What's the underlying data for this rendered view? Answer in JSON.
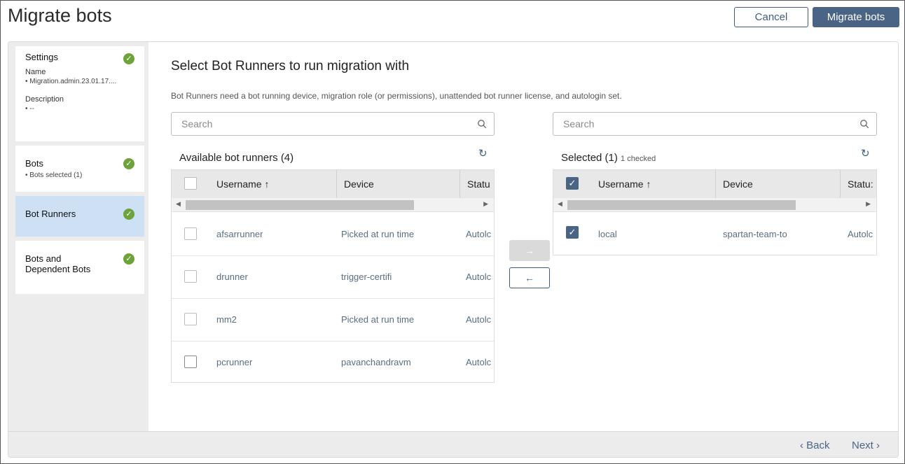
{
  "header": {
    "title": "Migrate bots",
    "cancel_label": "Cancel",
    "migrate_label": "Migrate bots"
  },
  "sidebar": {
    "steps": [
      {
        "title": "Settings",
        "completed": true,
        "fields": [
          {
            "label": "Name",
            "value": "• Migration.admin.23.01.17...."
          },
          {
            "label": "Description",
            "value": "• --"
          }
        ]
      },
      {
        "title": "Bots",
        "completed": true,
        "detail": "• Bots selected (1)"
      },
      {
        "title": "Bot Runners",
        "completed": true,
        "active": true
      },
      {
        "title": "Bots and\nDependent Bots",
        "title_line1": "Bots and",
        "title_line2": "Dependent Bots",
        "completed": true
      }
    ]
  },
  "main": {
    "heading": "Select Bot Runners to run migration with",
    "description": "Bot Runners need a bot running device, migration role (or permissions), unattended bot runner license, and autologin set.",
    "available": {
      "search_placeholder": "Search",
      "label": "Available bot runners (4)",
      "columns": [
        "Username ↑",
        "Device",
        "Statu"
      ],
      "rows": [
        {
          "username": "afsarrunner",
          "device": "Picked at run time",
          "status": "Autolc"
        },
        {
          "username": "drunner",
          "device": "trigger-certifi",
          "status": "Autolc"
        },
        {
          "username": "mm2",
          "device": "Picked at run time",
          "status": "Autolc"
        },
        {
          "username": "pcrunner",
          "device": "pavanchandravm",
          "status": "Autolc"
        }
      ]
    },
    "selected": {
      "search_placeholder": "Search",
      "label": "Selected (1)",
      "checked_note": "1 checked",
      "columns": [
        "Username ↑",
        "Device",
        "Statu:"
      ],
      "rows": [
        {
          "username": "local",
          "device": "spartan-team-to",
          "status": "Autolc",
          "checked": true
        }
      ]
    },
    "move_right_label": "→",
    "move_left_label": "←"
  },
  "footer": {
    "back_label": "‹ Back",
    "next_label": "Next ›"
  },
  "colors": {
    "accent": "#4a6486",
    "success": "#6ea33b",
    "active_step": "#cde0f4"
  }
}
